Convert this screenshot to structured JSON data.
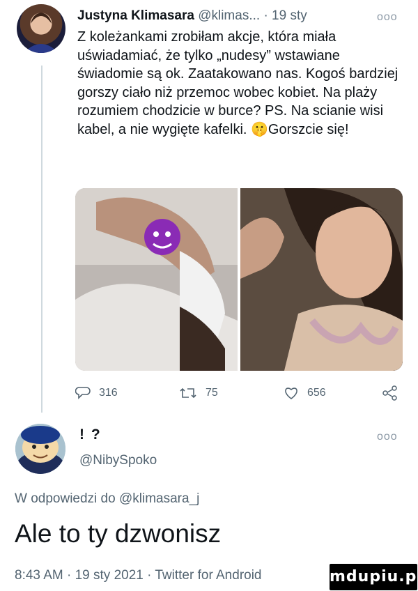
{
  "tweet": {
    "author_name": "Justyna Klimasara",
    "author_handle": "@klimas...",
    "time": "· 19 sty",
    "more_label": "ooo",
    "text": "Z koleżankami zrobiłam akcje, która miała uświadamiać, że tylko „nudesy” wstawiane świadomie są ok. Zaatakowano nas. Kogoś bardziej gorszy ciało niż przemoc wobec kobiet. Na plaży rozumiem chodzicie w burce? PS. Na scianie wisi kabel, a nie wygięte kafelki. 🤫Gorszcie się!",
    "stats": {
      "replies": "316",
      "retweets": "75",
      "likes": "656"
    }
  },
  "reply": {
    "author_name": "! ?",
    "author_handle": "@NibySpoko",
    "more_label": "ooo",
    "in_reply_prefix": "W odpowiedzi do",
    "in_reply_handle": "@klimasara_j",
    "text": "Ale to ty dzwonisz",
    "meta": "8:43 AM · 19 sty 2021 · Twitter for Android"
  },
  "watermark": "mdupiu.pl",
  "colors": {
    "text_primary": "#0f1419",
    "text_secondary": "#536471",
    "divider": "#cfd9de"
  },
  "icons": [
    "reply-icon",
    "retweet-icon",
    "like-icon",
    "share-icon",
    "more-icon"
  ]
}
